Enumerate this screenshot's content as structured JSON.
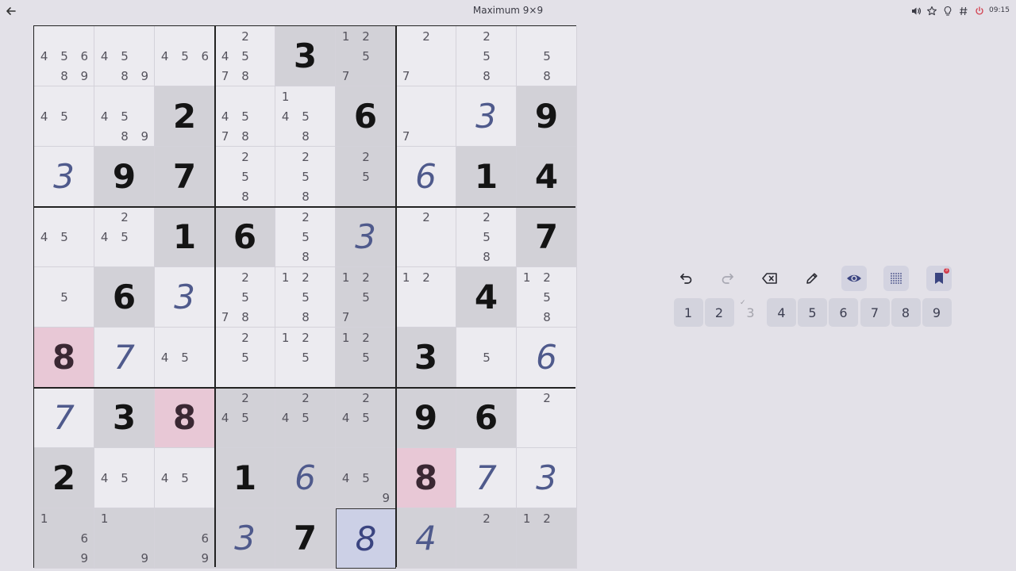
{
  "header": {
    "title": "Maximum 9×9",
    "clock": "09:15"
  },
  "colors": {
    "background": "#e3e1e8",
    "given_cell": "#d2d1d7",
    "highlight_cell": "#e8c8d6",
    "selected_cell": "#ccd0e6",
    "user_digit": "#4f5a8c"
  },
  "board": {
    "cells": [
      [
        {
          "bg": "light",
          "notes": [
            4,
            5,
            6,
            8,
            9
          ]
        },
        {
          "bg": "light",
          "notes": [
            4,
            5,
            8,
            9
          ]
        },
        {
          "bg": "light",
          "notes": [
            4,
            5,
            6
          ]
        },
        {
          "bg": "light",
          "notes": [
            2,
            4,
            5,
            7,
            8
          ]
        },
        {
          "bg": "given",
          "value": "3",
          "kind": "given"
        },
        {
          "bg": "given",
          "notes": [
            1,
            2,
            5,
            7
          ]
        },
        {
          "bg": "light",
          "notes": [
            2,
            7
          ]
        },
        {
          "bg": "light",
          "notes": [
            2,
            5,
            8
          ]
        },
        {
          "bg": "light",
          "notes": [
            5,
            8
          ]
        }
      ],
      [
        {
          "bg": "light",
          "notes": [
            4,
            5
          ]
        },
        {
          "bg": "light",
          "notes": [
            4,
            5,
            8,
            9
          ]
        },
        {
          "bg": "given",
          "value": "2",
          "kind": "given"
        },
        {
          "bg": "light",
          "notes": [
            4,
            5,
            7,
            8
          ]
        },
        {
          "bg": "light",
          "notes": [
            1,
            4,
            5,
            8
          ]
        },
        {
          "bg": "given",
          "value": "6",
          "kind": "given"
        },
        {
          "bg": "light",
          "notes": [
            7
          ]
        },
        {
          "bg": "light",
          "value": "3",
          "kind": "user"
        },
        {
          "bg": "given",
          "value": "9",
          "kind": "given"
        }
      ],
      [
        {
          "bg": "light",
          "value": "3",
          "kind": "user"
        },
        {
          "bg": "given",
          "value": "9",
          "kind": "given"
        },
        {
          "bg": "given",
          "value": "7",
          "kind": "given"
        },
        {
          "bg": "light",
          "notes": [
            2,
            5,
            8
          ]
        },
        {
          "bg": "light",
          "notes": [
            2,
            5,
            8
          ]
        },
        {
          "bg": "given",
          "notes": [
            2,
            5
          ]
        },
        {
          "bg": "light",
          "value": "6",
          "kind": "user"
        },
        {
          "bg": "given",
          "value": "1",
          "kind": "given"
        },
        {
          "bg": "given",
          "value": "4",
          "kind": "given"
        }
      ],
      [
        {
          "bg": "light",
          "notes": [
            4,
            5
          ]
        },
        {
          "bg": "light",
          "notes": [
            2,
            4,
            5
          ]
        },
        {
          "bg": "given",
          "value": "1",
          "kind": "given"
        },
        {
          "bg": "given",
          "value": "6",
          "kind": "given"
        },
        {
          "bg": "light",
          "notes": [
            2,
            5,
            8
          ]
        },
        {
          "bg": "given",
          "value": "3",
          "kind": "user"
        },
        {
          "bg": "light",
          "notes": [
            2
          ]
        },
        {
          "bg": "light",
          "notes": [
            2,
            5,
            8
          ]
        },
        {
          "bg": "given",
          "value": "7",
          "kind": "given"
        }
      ],
      [
        {
          "bg": "light",
          "notes": [
            5
          ]
        },
        {
          "bg": "given",
          "value": "6",
          "kind": "given"
        },
        {
          "bg": "light",
          "value": "3",
          "kind": "user"
        },
        {
          "bg": "light",
          "notes": [
            2,
            5,
            7,
            8
          ]
        },
        {
          "bg": "light",
          "notes": [
            1,
            2,
            5,
            8
          ]
        },
        {
          "bg": "given",
          "notes": [
            1,
            2,
            5,
            7
          ]
        },
        {
          "bg": "light",
          "notes": [
            1,
            2
          ]
        },
        {
          "bg": "given",
          "value": "4",
          "kind": "given"
        },
        {
          "bg": "light",
          "notes": [
            1,
            2,
            5,
            8
          ]
        }
      ],
      [
        {
          "bg": "hi",
          "value": "8",
          "kind": "hi"
        },
        {
          "bg": "light",
          "value": "7",
          "kind": "user"
        },
        {
          "bg": "light",
          "notes": [
            4,
            5
          ]
        },
        {
          "bg": "light",
          "notes": [
            2,
            5
          ]
        },
        {
          "bg": "light",
          "notes": [
            1,
            2,
            5
          ]
        },
        {
          "bg": "given",
          "notes": [
            1,
            2,
            5
          ]
        },
        {
          "bg": "given",
          "value": "3",
          "kind": "given"
        },
        {
          "bg": "light",
          "notes": [
            5
          ]
        },
        {
          "bg": "light",
          "value": "6",
          "kind": "user"
        }
      ],
      [
        {
          "bg": "light",
          "value": "7",
          "kind": "user"
        },
        {
          "bg": "given",
          "value": "3",
          "kind": "given"
        },
        {
          "bg": "hi",
          "value": "8",
          "kind": "hi"
        },
        {
          "bg": "given",
          "notes": [
            2,
            4,
            5
          ]
        },
        {
          "bg": "given",
          "notes": [
            2,
            4,
            5
          ]
        },
        {
          "bg": "given",
          "notes": [
            2,
            4,
            5
          ]
        },
        {
          "bg": "given",
          "value": "9",
          "kind": "given"
        },
        {
          "bg": "given",
          "value": "6",
          "kind": "given"
        },
        {
          "bg": "light",
          "notes": [
            2
          ]
        }
      ],
      [
        {
          "bg": "given",
          "value": "2",
          "kind": "given"
        },
        {
          "bg": "light",
          "notes": [
            4,
            5
          ]
        },
        {
          "bg": "light",
          "notes": [
            4,
            5
          ]
        },
        {
          "bg": "given",
          "value": "1",
          "kind": "given"
        },
        {
          "bg": "given",
          "value": "6",
          "kind": "user"
        },
        {
          "bg": "given",
          "notes": [
            4,
            5,
            9
          ]
        },
        {
          "bg": "hi",
          "value": "8",
          "kind": "hi"
        },
        {
          "bg": "light",
          "value": "7",
          "kind": "user"
        },
        {
          "bg": "light",
          "value": "3",
          "kind": "user"
        }
      ],
      [
        {
          "bg": "given",
          "notes": [
            1,
            6,
            9
          ]
        },
        {
          "bg": "given",
          "notes": [
            1,
            9
          ]
        },
        {
          "bg": "given",
          "notes": [
            6,
            9
          ]
        },
        {
          "bg": "given",
          "value": "3",
          "kind": "user"
        },
        {
          "bg": "given",
          "value": "7",
          "kind": "given"
        },
        {
          "bg": "sel",
          "value": "8",
          "kind": "sel"
        },
        {
          "bg": "given",
          "value": "4",
          "kind": "user"
        },
        {
          "bg": "given",
          "notes": [
            2
          ]
        },
        {
          "bg": "given",
          "notes": [
            1,
            2
          ]
        }
      ]
    ]
  },
  "toolbar": {
    "undo_icon": "undo-icon",
    "redo_icon": "redo-icon",
    "erase_icon": "backspace-icon",
    "pencil_icon": "pencil-icon",
    "eye_icon": "eye-icon",
    "grid_icon": "dots-grid-icon",
    "bookmark_icon": "bookmark-icon",
    "bookmark_badge": "3"
  },
  "numpad": {
    "buttons": [
      {
        "label": "1",
        "done": false
      },
      {
        "label": "2",
        "done": false
      },
      {
        "label": "3",
        "done": true
      },
      {
        "label": "4",
        "done": false
      },
      {
        "label": "5",
        "done": false
      },
      {
        "label": "6",
        "done": false
      },
      {
        "label": "7",
        "done": false
      },
      {
        "label": "8",
        "done": false
      },
      {
        "label": "9",
        "done": false
      }
    ]
  }
}
